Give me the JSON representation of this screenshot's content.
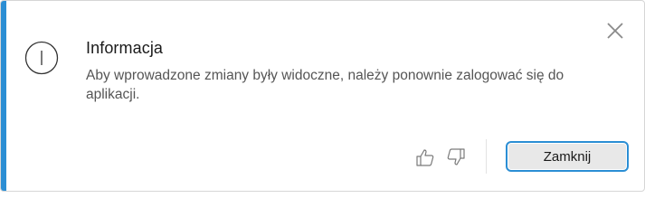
{
  "dialog": {
    "title": "Informacja",
    "message": "Aby wprowadzone zmiany były widoczne, należy ponownie zalogować się do aplikacji.",
    "close_label": "Zamknij",
    "icon": "info-icon",
    "accent_color": "#2b8ed4"
  },
  "feedback": {
    "like_icon": "thumbs-up-icon",
    "dislike_icon": "thumbs-down-icon"
  }
}
